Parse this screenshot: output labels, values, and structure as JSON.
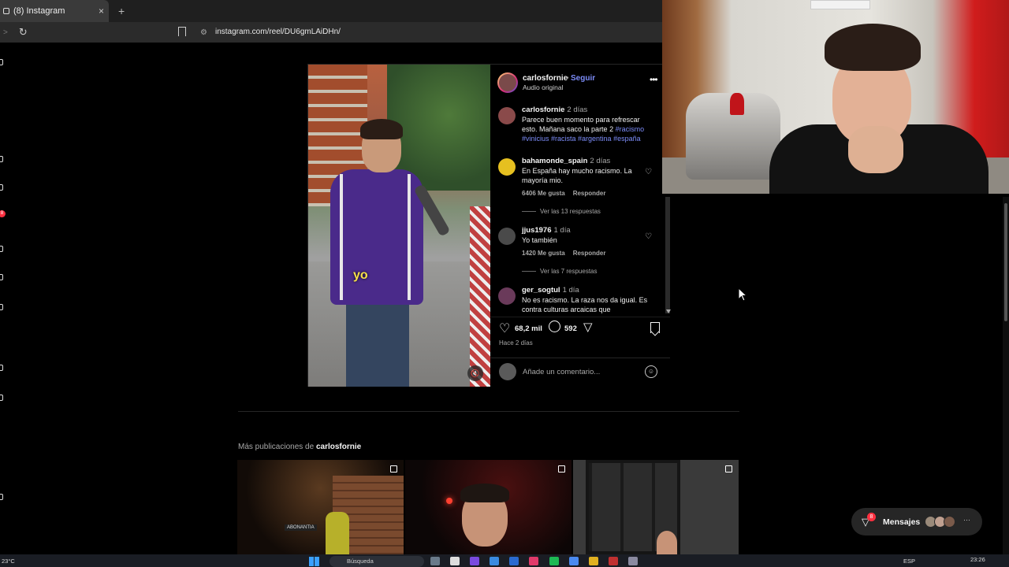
{
  "browser": {
    "tab_title": "(8) Instagram",
    "tab_close": "×",
    "new_tab": "+",
    "url": "instagram.com/reel/DU6gmLAiDHn/"
  },
  "sidebar": {
    "notification_count": "8"
  },
  "post": {
    "author": "carlosfornie",
    "dot": "•",
    "follow_label": "Seguir",
    "audio": "Audio original",
    "more": "•••",
    "video_caption": "yo",
    "comments": [
      {
        "user": "carlosfornie",
        "time": "2 días",
        "text": "Parece buen momento para refrescar esto. Mañana saco la parte 2",
        "tags": "#racismo #vinicius #racista #argentina #españa"
      },
      {
        "user": "bahamonde_spain",
        "time": "2 días",
        "text": "En España hay mucho racismo. La mayoría mio.",
        "likes": "6406 Me gusta",
        "reply": "Responder",
        "view_replies": "Ver las 13 respuestas"
      },
      {
        "user": "jjus1976",
        "time": "1 día",
        "text": "Yo también",
        "likes": "1420 Me gusta",
        "reply": "Responder",
        "view_replies": "Ver las 7 respuestas"
      },
      {
        "user": "ger_sogtul",
        "time": "1 día",
        "text": "No es racismo. La raza nos da igual. Es contra culturas arcaicas que"
      }
    ],
    "likes_count": "68,2 mil",
    "comments_count": "592",
    "posted": "Hace 2 días",
    "add_comment_placeholder": "Añade un comentario..."
  },
  "more_posts": {
    "prefix": "Más publicaciones de",
    "author": "carlosfornie",
    "thumb1_sign": "ABONANTIA"
  },
  "messages": {
    "label": "Mensajes",
    "badge": "8",
    "more": "···"
  },
  "taskbar": {
    "weather": "23°C",
    "search": "Búsqueda",
    "lang": "ESP",
    "clock": "23:26"
  },
  "colors": {
    "accent_link": "#7c8cf8",
    "badge_red": "#ff3040",
    "background": "#000000"
  }
}
